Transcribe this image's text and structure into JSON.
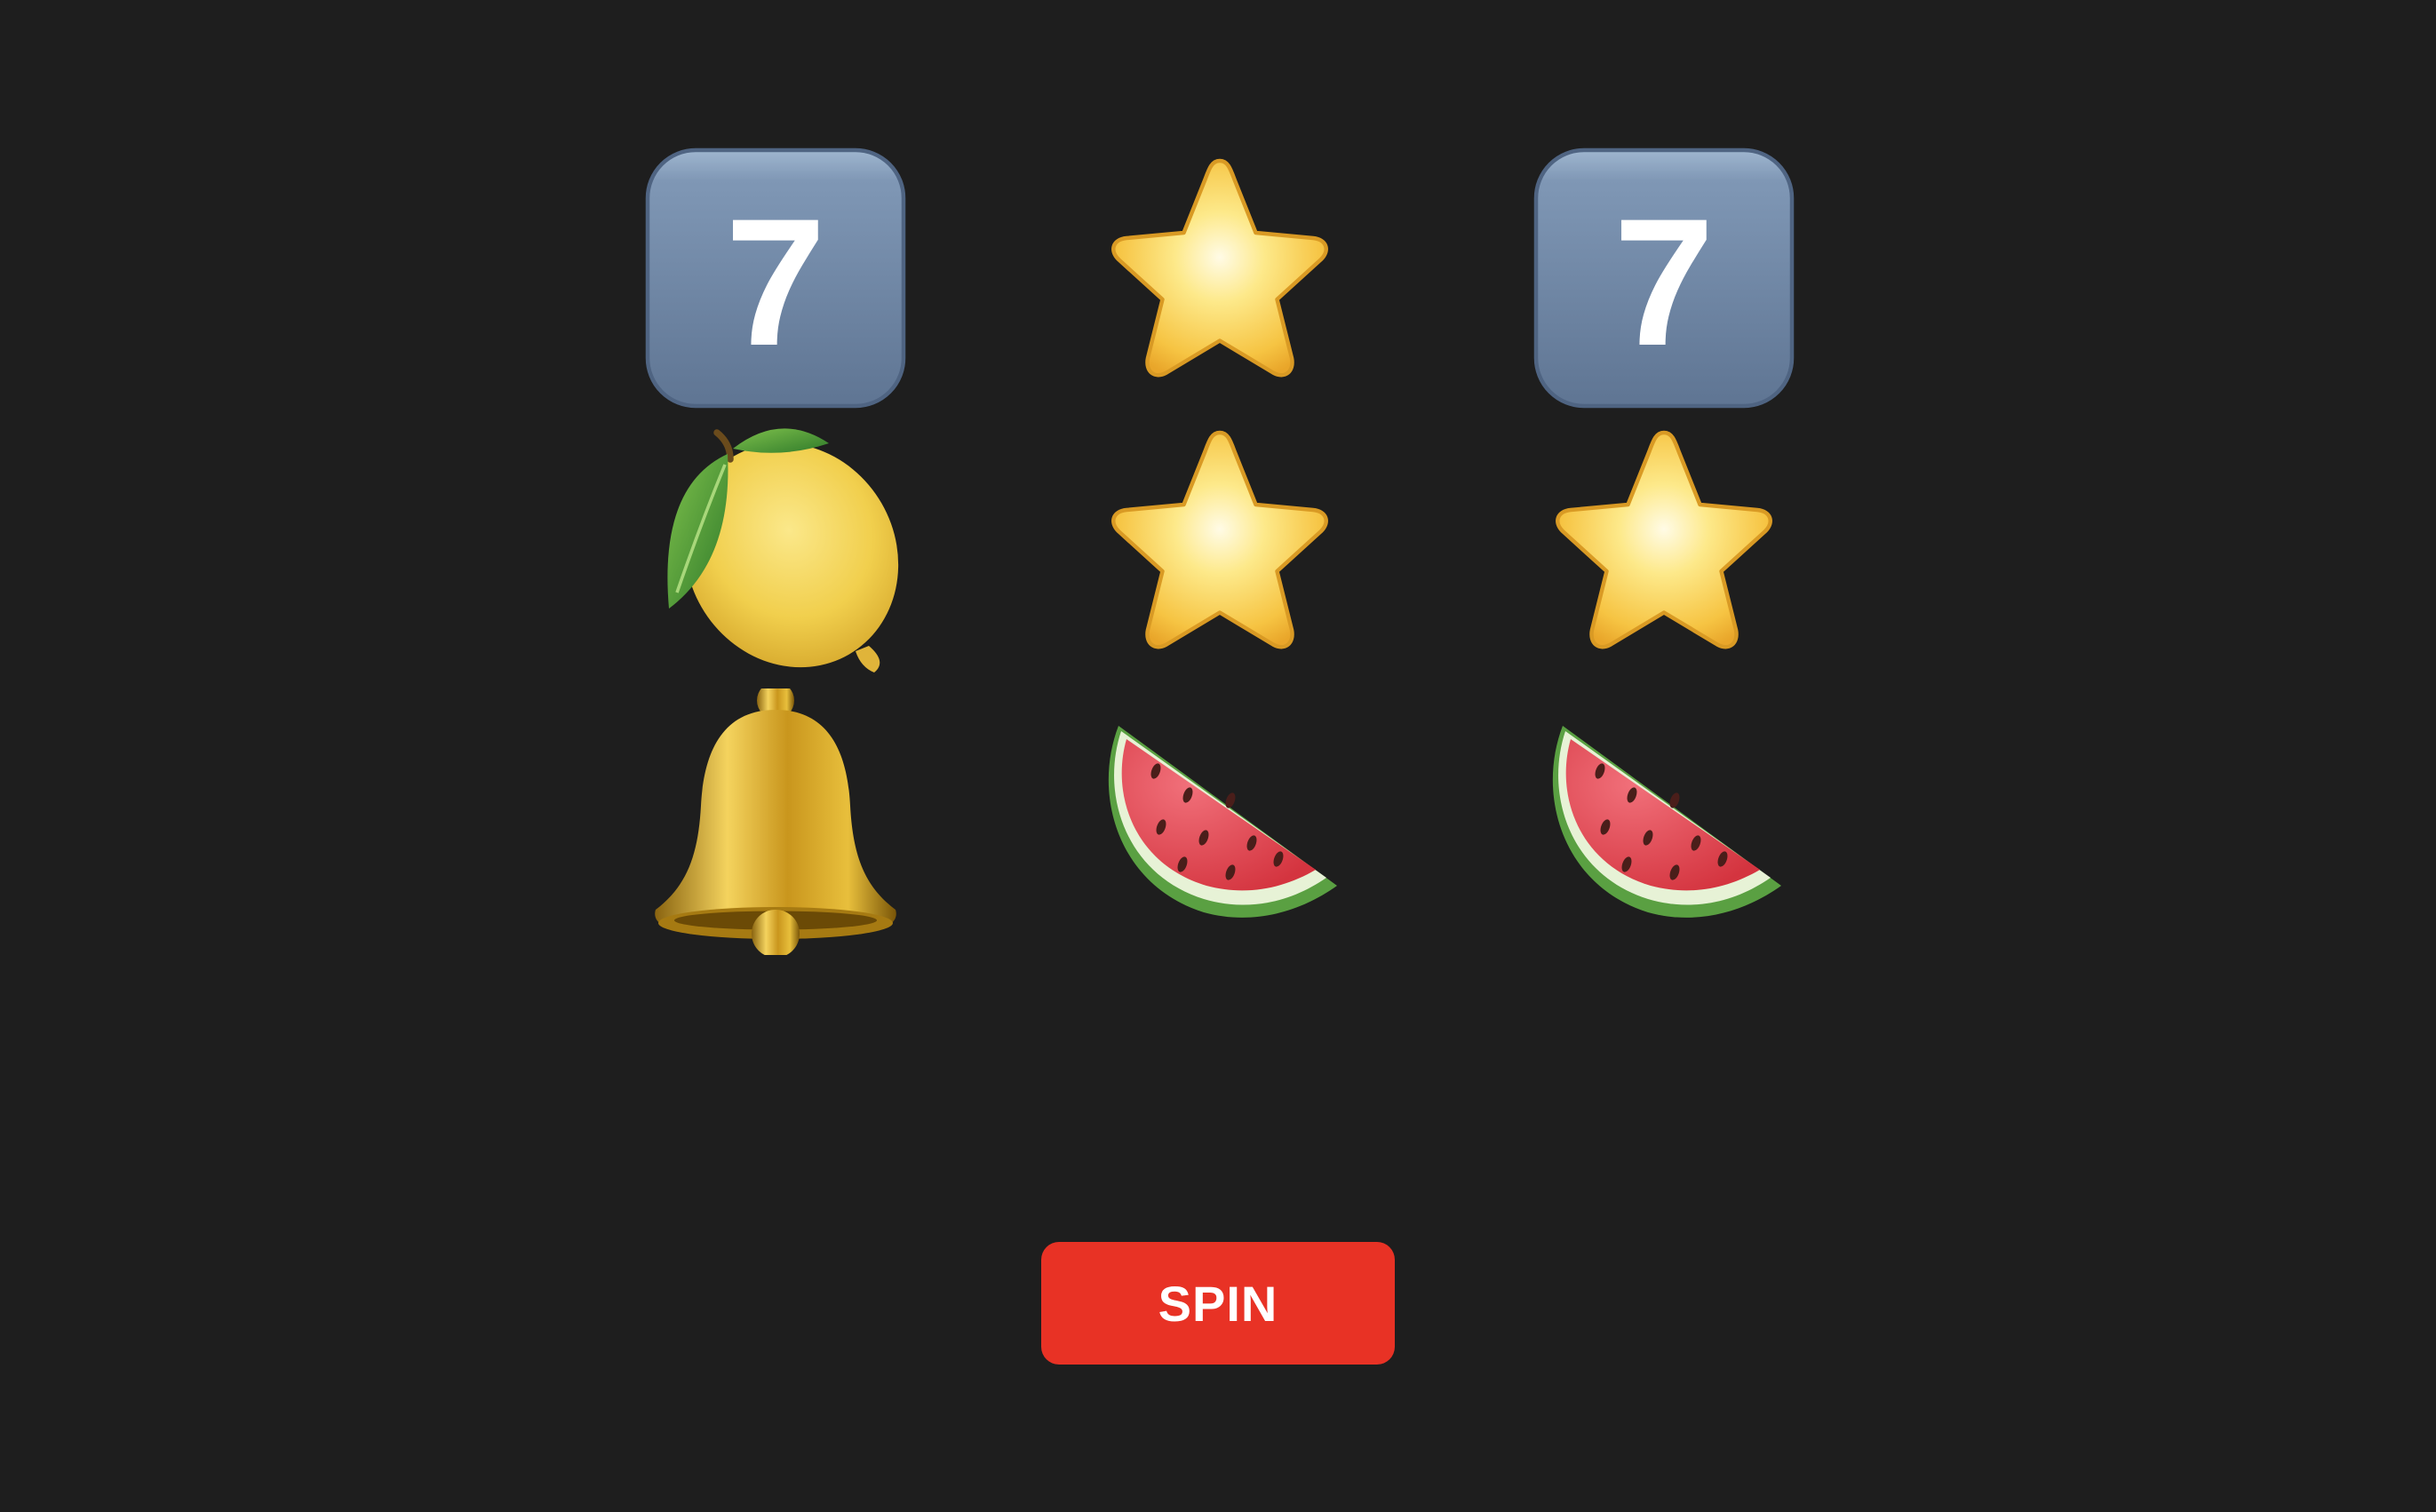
{
  "reels": [
    {
      "symbols": [
        "seven",
        "lemon",
        "bell"
      ]
    },
    {
      "symbols": [
        "star",
        "star",
        "watermelon"
      ]
    },
    {
      "symbols": [
        "seven",
        "star",
        "watermelon"
      ]
    }
  ],
  "symbol_text": {
    "seven": "7"
  },
  "spin_button": {
    "label": "SPIN"
  },
  "colors": {
    "background": "#1e1e1e",
    "spin_button": "#e83225",
    "spin_text": "#ffffff"
  }
}
